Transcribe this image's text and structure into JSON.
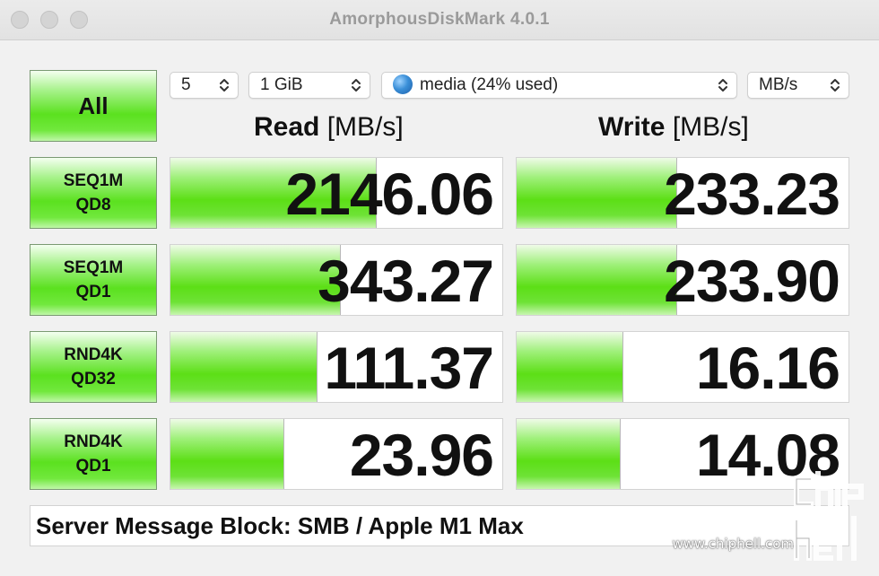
{
  "window": {
    "title": "AmorphousDiskMark 4.0.1"
  },
  "controls": {
    "all_label": "All",
    "count": "5",
    "size": "1 GiB",
    "target": "media (24% used)",
    "target_icon": "globe-icon",
    "unit": "MB/s"
  },
  "headers": {
    "read_strong": "Read",
    "read_unit": "[MB/s]",
    "write_strong": "Write",
    "write_unit": "[MB/s]"
  },
  "tests": [
    {
      "label": "SEQ1M\nQD8",
      "read": "2146.06",
      "write": "233.23",
      "read_fill": 0.62,
      "write_fill": 0.48
    },
    {
      "label": "SEQ1M\nQD1",
      "read": "343.27",
      "write": "233.90",
      "read_fill": 0.51,
      "write_fill": 0.48
    },
    {
      "label": "RND4K\nQD32",
      "read": "111.37",
      "write": "16.16",
      "read_fill": 0.44,
      "write_fill": 0.32
    },
    {
      "label": "RND4K\nQD1",
      "read": "23.96",
      "write": "14.08",
      "read_fill": 0.34,
      "write_fill": 0.31
    }
  ],
  "message": "Server Message Block: SMB / Apple M1 Max",
  "watermark": {
    "url": "www.chiphell.com",
    "logo_text": "chip hell"
  },
  "colors": {
    "bar_green": "#5cdf16",
    "title_gray": "#9a9a9a",
    "background": "#f1f1f1"
  }
}
